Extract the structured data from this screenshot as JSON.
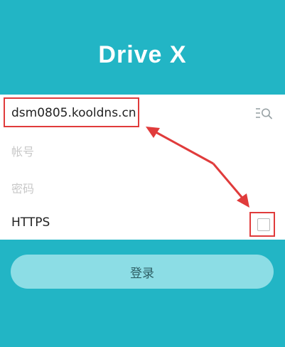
{
  "app": {
    "title": "Drive X"
  },
  "form": {
    "server_value": "dsm0805.kooldns.cn",
    "account_placeholder": "帐号",
    "password_placeholder": "密码",
    "https_label": "HTTPS",
    "https_checked": false
  },
  "actions": {
    "login_label": "登录"
  },
  "icons": {
    "search": "search-list-icon"
  },
  "colors": {
    "background": "#22b5c5",
    "panel": "#ffffff",
    "button": "#8cdde5",
    "annotation": "#e03b3b"
  }
}
